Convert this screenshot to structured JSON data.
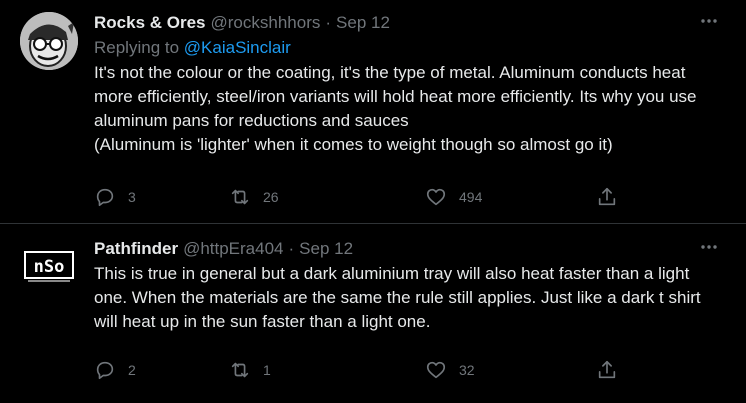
{
  "tweets": [
    {
      "name": "Rocks & Ores",
      "handle": "@rockshhhors",
      "separator": "·",
      "date": "Sep 12",
      "replying_to_prefix": "Replying to ",
      "replying_to": "@KaiaSinclair",
      "text_lines": [
        "It's not the colour or the coating, it's the type of metal. Aluminum conducts heat more efficiently, steel/iron variants will hold heat more efficiently. Its why you use aluminum pans for reductions and sauces",
        "(Aluminum is 'lighter' when it comes to weight though so almost go it)"
      ],
      "replies": "3",
      "retweets": "26",
      "likes": "494"
    },
    {
      "name": "Pathfinder",
      "handle": "@httpEra404",
      "separator": "·",
      "date": "Sep 12",
      "text_lines": [
        "This is true in general but a dark aluminium tray will also heat faster than a light one. When the materials are the same the rule still applies. Just like a dark t shirt will heat up in the sun faster than a light one."
      ],
      "replies": "2",
      "retweets": "1",
      "likes": "32"
    }
  ],
  "avatar2_text": "nSo",
  "colors": {
    "background": "#000000",
    "text": "#e7e9ea",
    "secondary": "#71767b",
    "link": "#1d9bf0",
    "divider": "#2f3336"
  },
  "icons": [
    "more-icon",
    "reply-icon",
    "retweet-icon",
    "like-icon",
    "share-icon"
  ]
}
